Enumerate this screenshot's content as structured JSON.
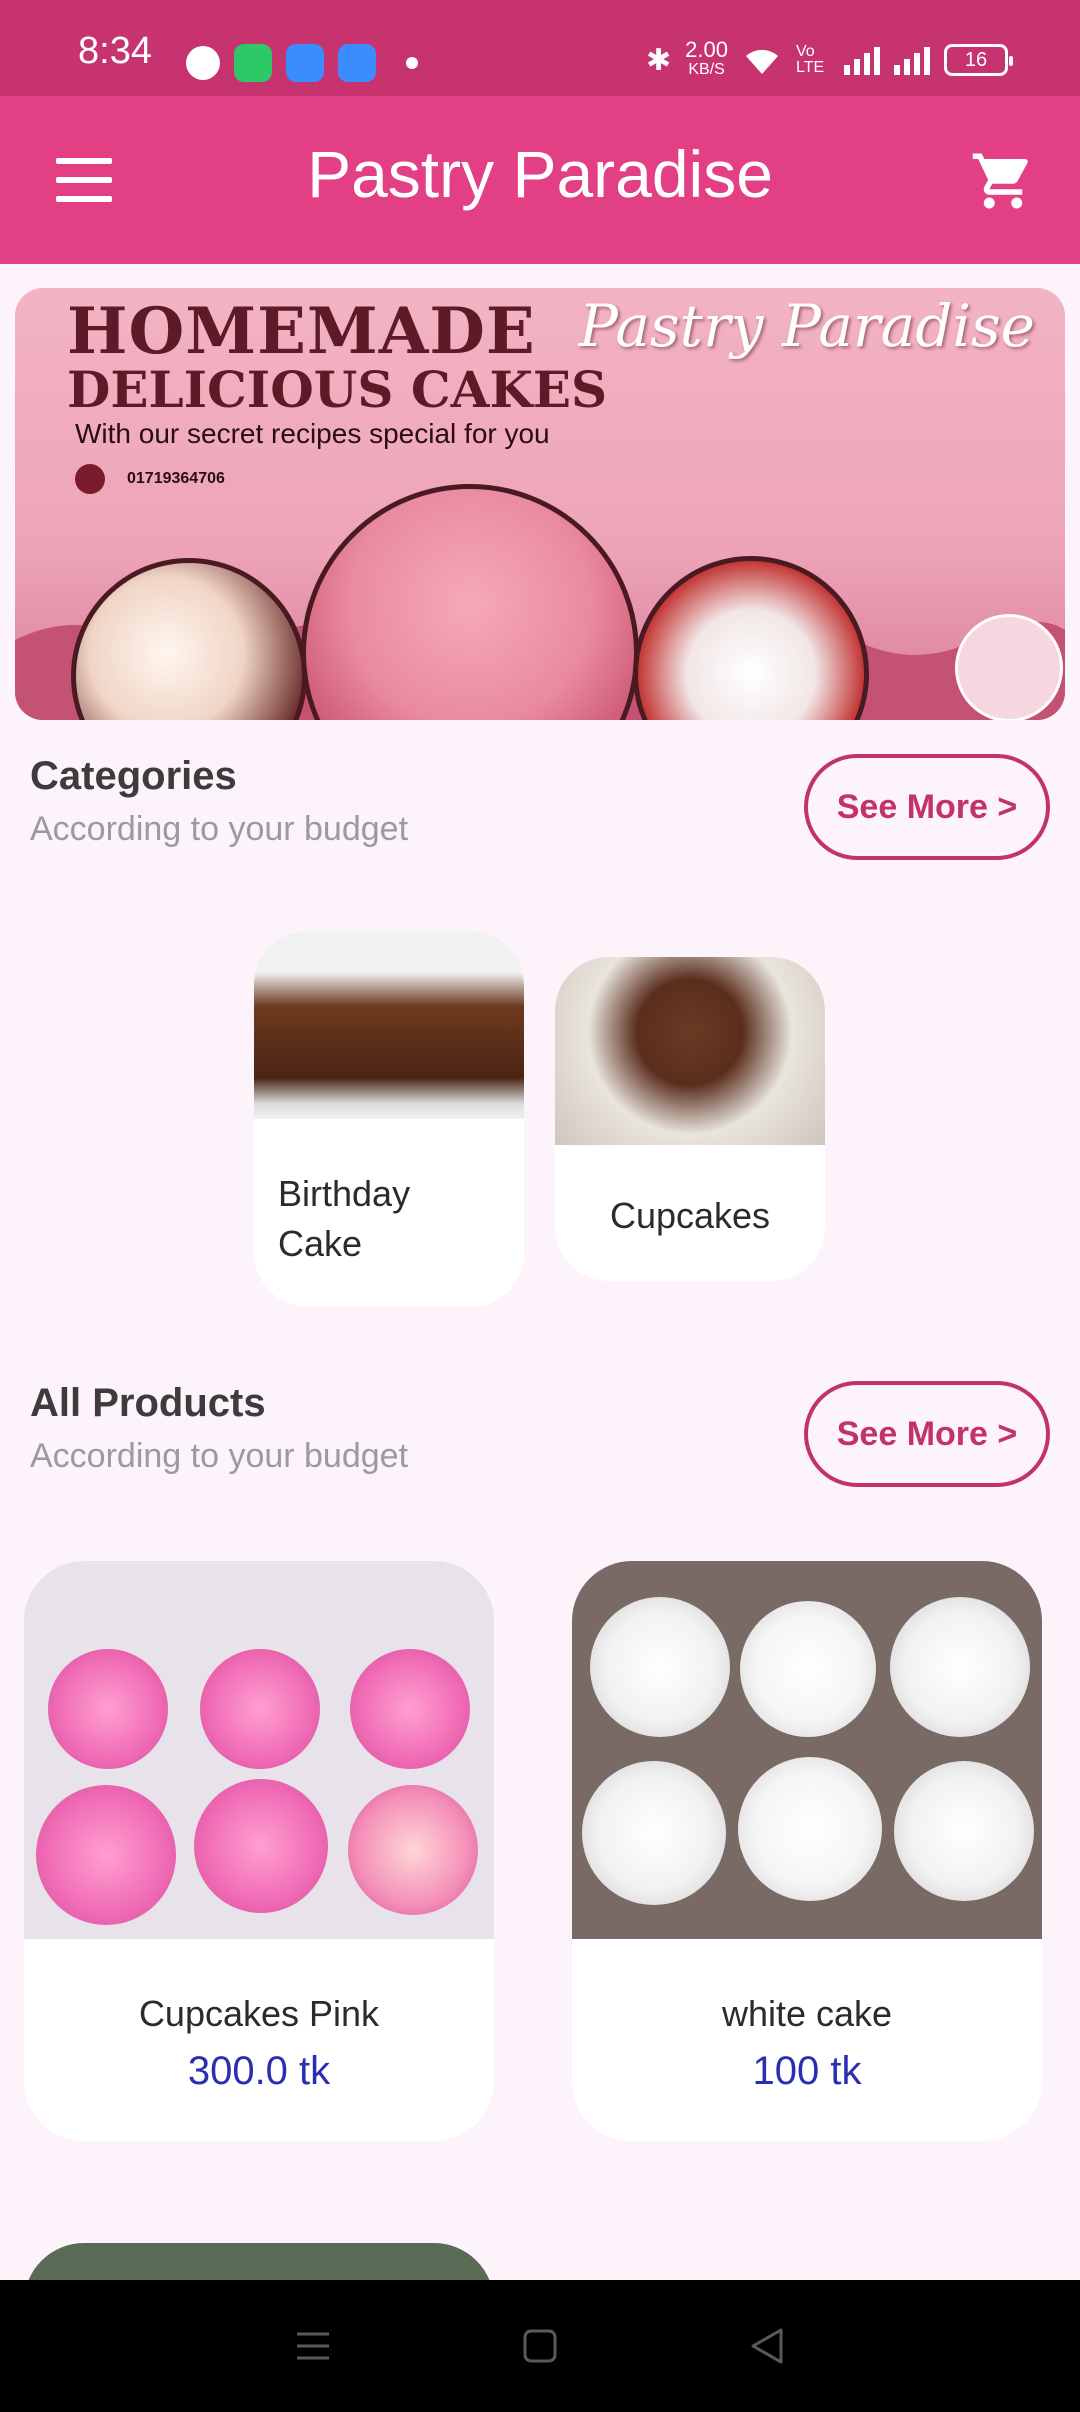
{
  "status_bar": {
    "time": "8:34",
    "net_speed": "2.00",
    "net_unit": "KB/S",
    "volte": "Vo LTE",
    "battery": "16"
  },
  "app_bar": {
    "title": "Pastry Paradise",
    "menu_icon": "hamburger-menu-icon",
    "cart_icon": "shopping-cart-icon"
  },
  "banner": {
    "headline_1": "HOMEMADE",
    "headline_2": "DELICIOUS CAKES",
    "tagline": "With our secret recipes special for you",
    "brand": "Pastry Paradise",
    "phone": "01719364706"
  },
  "categories": {
    "title": "Categories",
    "subtitle": "According to your budget",
    "see_more": "See More >",
    "items": [
      {
        "label": "Birthday Cake"
      },
      {
        "label": "Cupcakes"
      }
    ]
  },
  "products": {
    "title": "All Products",
    "subtitle": "According to your budget",
    "see_more": "See More >",
    "items": [
      {
        "name": "Cupcakes Pink",
        "price": "300.0 tk"
      },
      {
        "name": "white cake",
        "price": "100 tk"
      }
    ]
  },
  "colors": {
    "status_bar": "#c7336e",
    "app_bar": "#e23f84",
    "accent": "#c2336b",
    "price": "#2a2fb0",
    "background": "#fdf3fb"
  },
  "nav_bar": {
    "icons": [
      "recents-icon",
      "home-icon",
      "back-icon"
    ]
  }
}
